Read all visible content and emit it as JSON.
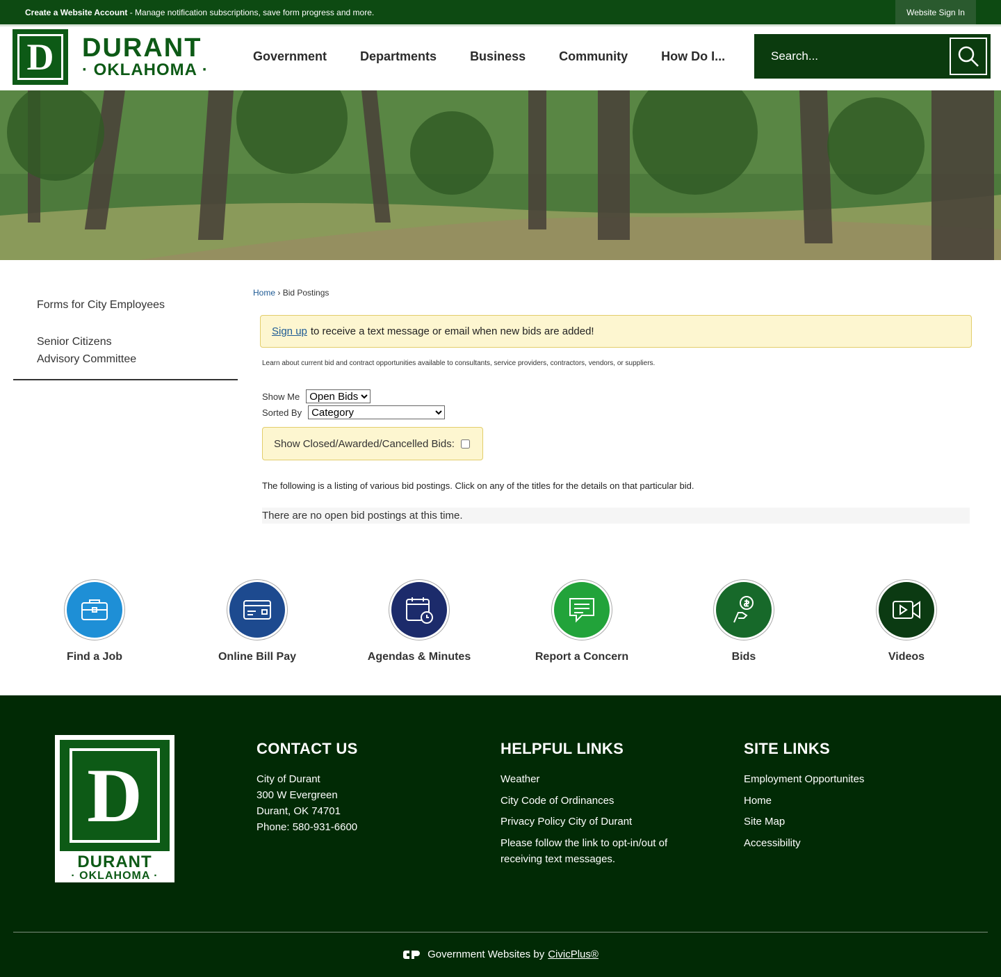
{
  "topbar": {
    "create_account": "Create a Website Account",
    "create_account_desc": " - Manage notification subscriptions, save form progress and more.",
    "sign_in": "Website Sign In"
  },
  "logo": {
    "letter": "D",
    "line1": "DURANT",
    "line2": "· OKLAHOMA ·"
  },
  "nav": [
    "Government",
    "Departments",
    "Business",
    "Community",
    "How Do I..."
  ],
  "search": {
    "placeholder": "Search..."
  },
  "sidebar": [
    "Forms for City Employees",
    "Senior Citizens Advisory Committee"
  ],
  "breadcrumb": {
    "home": "Home",
    "sep": " › ",
    "current": "Bid Postings"
  },
  "alert": {
    "link": "Sign up",
    "text": "to receive a text message or email when new bids are added!"
  },
  "intro": "Learn about current bid and contract opportunities available to consultants, service providers, contractors, vendors, or suppliers.",
  "filters": {
    "show_me_label": "Show Me",
    "show_me_value": "Open Bids",
    "sorted_by_label": "Sorted By",
    "sorted_by_value": "Category",
    "closed_label": "Show Closed/Awarded/Cancelled Bids:"
  },
  "listing_text": "The following is a listing of various bid postings. Click on any of the titles for the details on that particular bid.",
  "no_bids": "There are no open bid postings at this time.",
  "quick_links": [
    {
      "label": "Find a Job",
      "icon": "briefcase-icon",
      "color": "#1e8fd6"
    },
    {
      "label": "Online Bill Pay",
      "icon": "bill-icon",
      "color": "#1d4a8f"
    },
    {
      "label": "Agendas & Minutes",
      "icon": "calendar-icon",
      "color": "#1c2b6b"
    },
    {
      "label": "Report a Concern",
      "icon": "chat-icon",
      "color": "#22a33a"
    },
    {
      "label": "Bids",
      "icon": "hand-dollar-icon",
      "color": "#17692a"
    },
    {
      "label": "Videos",
      "icon": "video-icon",
      "color": "#0b3a12"
    }
  ],
  "footer": {
    "logo_line1": "DURANT",
    "logo_line2": "· OKLAHOMA ·",
    "contact": {
      "heading": "CONTACT US",
      "name": "City of Durant",
      "address1": "300 W Evergreen",
      "address2": "Durant, OK 74701",
      "phone": "Phone: 580-931-6600"
    },
    "helpful": {
      "heading": "HELPFUL LINKS",
      "links": [
        "Weather",
        "City Code of Ordinances",
        "Privacy Policy City of Durant",
        "Please follow the link to opt-in/out of receiving text messages."
      ]
    },
    "site": {
      "heading": "SITE LINKS",
      "links": [
        "Employment Opportunites",
        "Home",
        "Site Map",
        "Accessibility"
      ]
    },
    "credit_text": "Government Websites by",
    "credit_link": "CivicPlus®"
  },
  "colors": {
    "brand_green": "#0d5a16",
    "footer_bg": "#012a05",
    "alert_bg": "#fdf6d0"
  }
}
